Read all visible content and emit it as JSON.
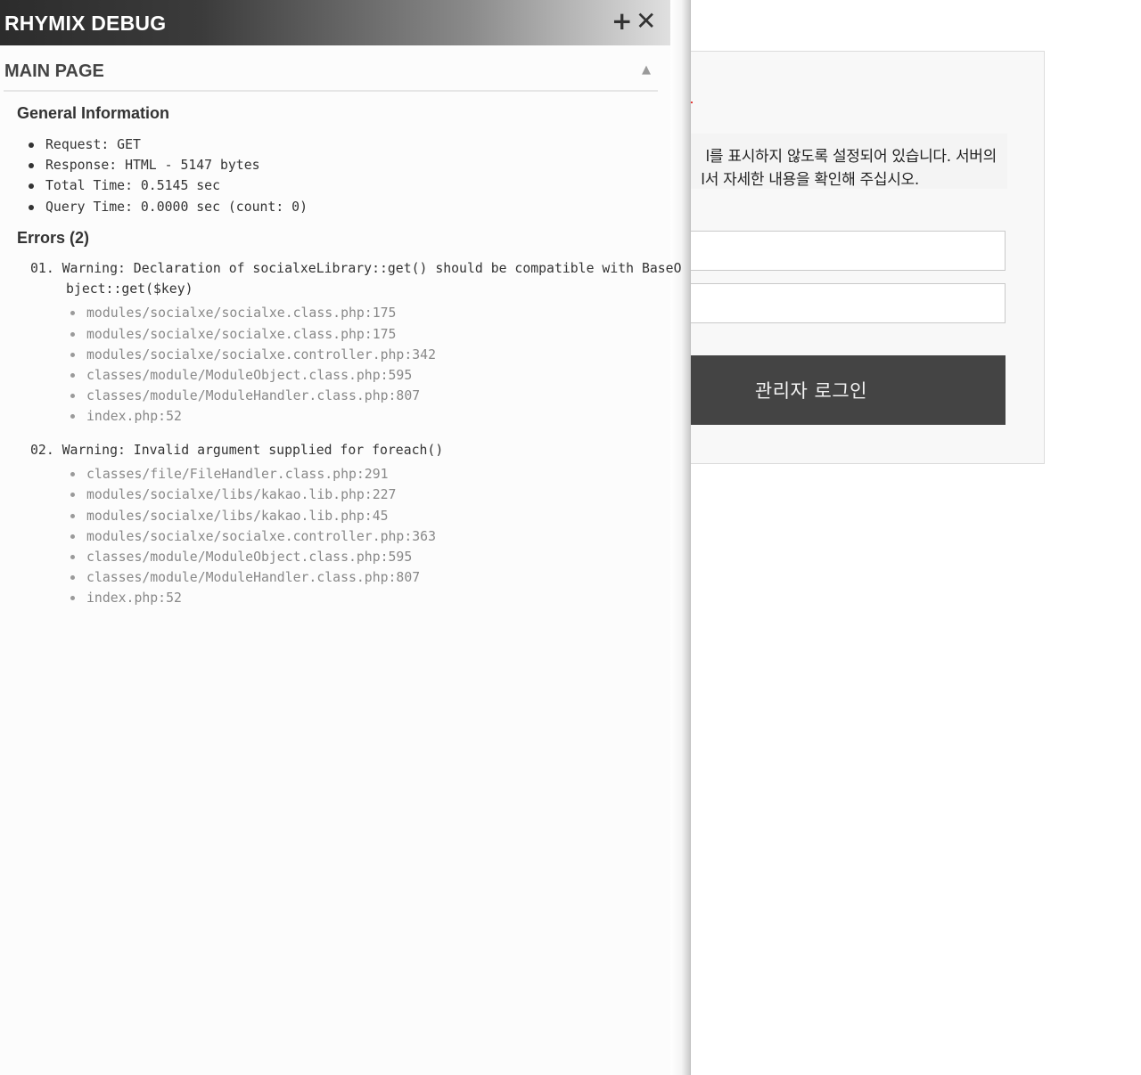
{
  "debug": {
    "title": "RHYMIX DEBUG",
    "add_icon": "+",
    "close_icon": "✕",
    "section_title": "MAIN PAGE",
    "collapse_icon": "▲",
    "general": {
      "title": "General Information",
      "items": [
        "Request: GET",
        "Response: HTML - 5147 bytes",
        "Total Time: 0.5145 sec",
        "Query Time: 0.0000 sec (count: 0)"
      ]
    },
    "errors": {
      "title": "Errors (2)",
      "list": [
        {
          "message": "01. Warning: Declaration of socialxeLibrary::get() should be compatible with BaseObject::get($key)",
          "trace": [
            "modules/socialxe/socialxe.class.php:175",
            "modules/socialxe/socialxe.class.php:175",
            "modules/socialxe/socialxe.controller.php:342",
            "classes/module/ModuleObject.class.php:595",
            "classes/module/ModuleHandler.class.php:807",
            "index.php:52"
          ]
        },
        {
          "message": "02. Warning: Invalid argument supplied for foreach()",
          "trace": [
            "classes/file/FileHandler.class.php:291",
            "modules/socialxe/libs/kakao.lib.php:227",
            "modules/socialxe/libs/kakao.lib.php:45",
            "modules/socialxe/socialxe.controller.php:363",
            "classes/module/ModuleObject.class.php:595",
            "classes/module/ModuleHandler.class.php:807",
            "index.php:52"
          ]
        }
      ]
    }
  },
  "background": {
    "notice_line1": "l를 표시하지 않도록 설정되어 있습니다. 서버의",
    "notice_line2": "l서 자세한 내용을 확인해 주십시오.",
    "login_button": "관리자 로그인",
    "button_color": "#444444"
  }
}
